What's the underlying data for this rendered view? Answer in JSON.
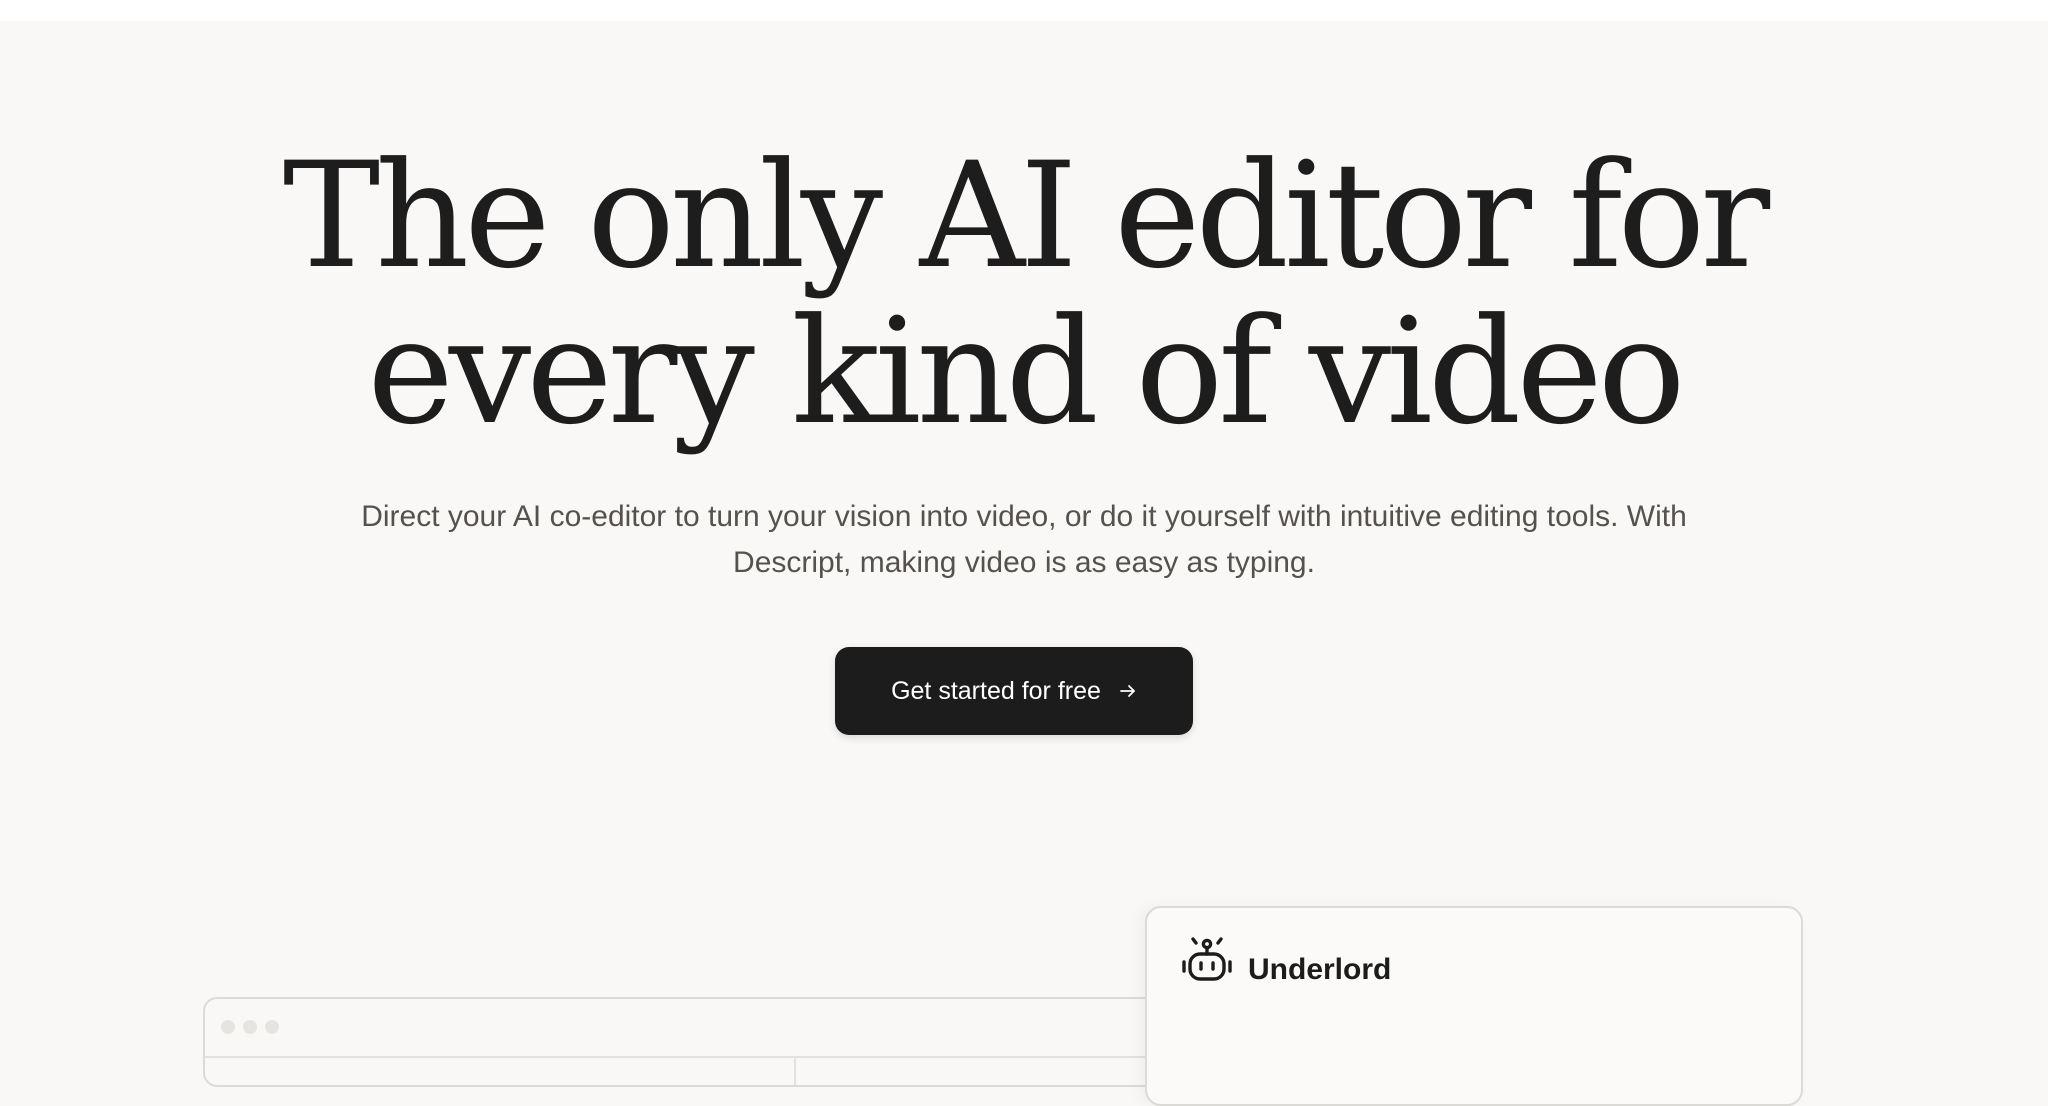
{
  "hero": {
    "title_line1": "The only AI editor for",
    "title_line2": "every kind of video",
    "subtitle_line1": "Direct your AI co-editor to turn your vision into video, or do it yourself with intuitive editing tools. With",
    "subtitle_line2": "Descript, making video is as easy as typing.",
    "cta_label": "Get started for free",
    "cta_icon": "arrow-right-icon"
  },
  "underlord_panel": {
    "title": "Underlord",
    "icon": "robot-icon"
  },
  "editor_window": {
    "icons": [
      "window-dot",
      "window-dot",
      "window-dot"
    ]
  },
  "colors": {
    "background": "#f9f8f6",
    "text": "#1c1c1c",
    "subtitle": "#55524e",
    "button": "#1c1c1c",
    "button_text": "#ffffff"
  }
}
